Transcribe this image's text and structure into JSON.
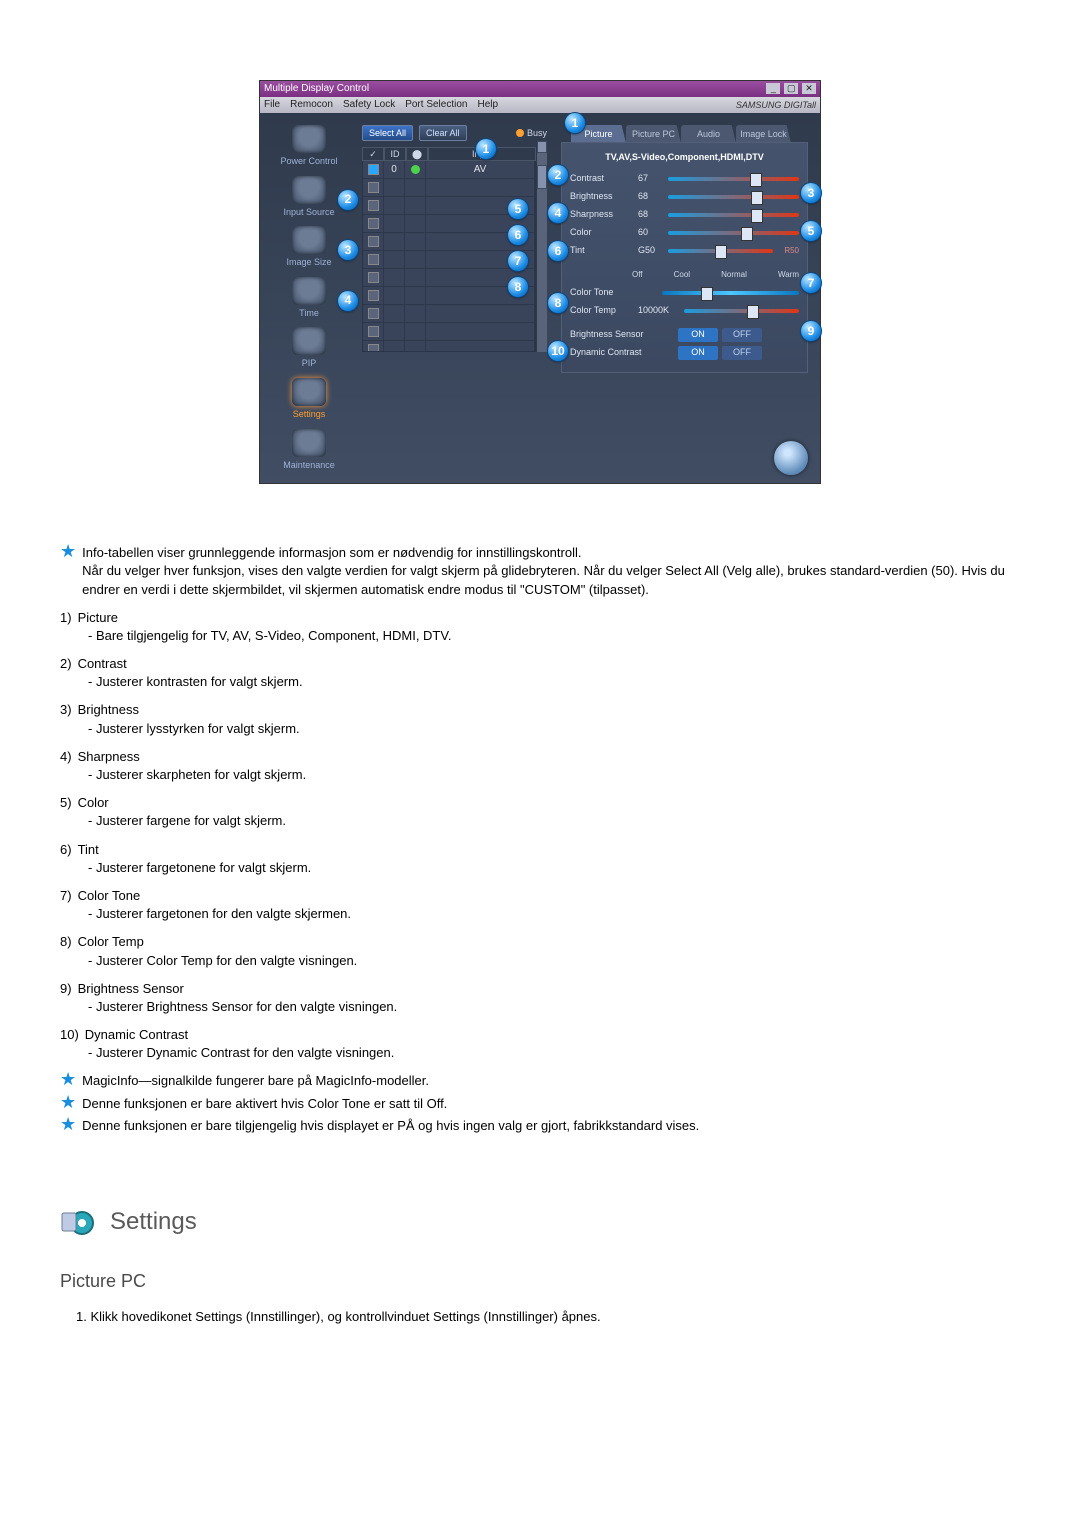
{
  "app": {
    "title": "Multiple Display Control",
    "window_buttons": [
      "_",
      "▢",
      "✕"
    ],
    "menu": [
      "File",
      "Remocon",
      "Safety Lock",
      "Port Selection",
      "Help"
    ],
    "brand": "SAMSUNG DIGITall",
    "sidebar": [
      {
        "label": "Power Control"
      },
      {
        "label": "Input Source"
      },
      {
        "label": "Image Size"
      },
      {
        "label": "Time"
      },
      {
        "label": "PIP"
      },
      {
        "label": "Settings",
        "active": true
      },
      {
        "label": "Maintenance"
      }
    ],
    "buttons": {
      "select_all": "Select All",
      "clear_all": "Clear All",
      "busy": "Busy"
    },
    "grid": {
      "headers": {
        "id": "ID",
        "input": "Input"
      },
      "input_value": "AV",
      "id_first": "0"
    },
    "tabs": [
      "Picture",
      "Picture PC",
      "Audio",
      "Image Lock"
    ],
    "panel_caption": "TV,AV,S-Video,Component,HDMI,DTV",
    "sliders": {
      "contrast": {
        "label": "Contrast",
        "value": "67"
      },
      "brightness": {
        "label": "Brightness",
        "value": "68"
      },
      "sharpness": {
        "label": "Sharpness",
        "value": "68"
      },
      "color": {
        "label": "Color",
        "value": "60"
      },
      "tint": {
        "label": "Tint",
        "left": "G50",
        "right": "R50"
      }
    },
    "tone": {
      "label": "Color Tone",
      "options": [
        "Off",
        "Cool",
        "Normal",
        "Warm"
      ]
    },
    "temp": {
      "label": "Color Temp",
      "value": "10000K"
    },
    "bs": {
      "label": "Brightness Sensor",
      "on": "ON",
      "off": "OFF"
    },
    "dc": {
      "label": "Dynamic Contrast",
      "on": "ON",
      "off": "OFF"
    }
  },
  "callouts": [
    "1",
    "2",
    "3",
    "4",
    "5",
    "6",
    "7",
    "8",
    "9",
    "10"
  ],
  "side_badges": [
    "2",
    "3",
    "4"
  ],
  "center_badges": [
    "1",
    "5",
    "6",
    "7",
    "8"
  ],
  "right_badges": [
    "2",
    "3",
    "4",
    "5",
    "6",
    "7",
    "8",
    "9"
  ],
  "doc": {
    "intro": [
      "Info-tabellen viser grunnleggende informasjon som er nødvendig for innstillingskontroll.",
      "Når du velger hver funksjon, vises den valgte verdien for valgt skjerm på glidebryteren. Når du velger Select All (Velg alle), brukes standard-verdien (50). Hvis du endrer en verdi i dette skjermbildet, vil skjermen automatisk endre modus til \"CUSTOM\" (tilpasset)."
    ],
    "items": [
      {
        "n": "1)",
        "t": "Picture",
        "s": "- Bare tilgjengelig for TV, AV, S-Video, Component, HDMI, DTV."
      },
      {
        "n": "2)",
        "t": "Contrast",
        "s": "- Justerer kontrasten for valgt skjerm."
      },
      {
        "n": "3)",
        "t": "Brightness",
        "s": "- Justerer lysstyrken for valgt skjerm."
      },
      {
        "n": "4)",
        "t": "Sharpness",
        "s": "- Justerer skarpheten for valgt skjerm."
      },
      {
        "n": "5)",
        "t": "Color",
        "s": "- Justerer fargene for valgt skjerm."
      },
      {
        "n": "6)",
        "t": "Tint",
        "s": "- Justerer fargetonene for valgt skjerm."
      },
      {
        "n": "7)",
        "t": "Color Tone",
        "s": "- Justerer fargetonen for den valgte skjermen."
      },
      {
        "n": "8)",
        "t": "Color Temp",
        "s": "- Justerer Color Temp for den valgte visningen."
      },
      {
        "n": "9)",
        "t": "Brightness Sensor",
        "s": "- Justerer Brightness Sensor for den valgte visningen."
      },
      {
        "n": "10)",
        "t": "Dynamic Contrast",
        "s": "- Justerer Dynamic Contrast for den valgte visningen."
      }
    ],
    "notes": [
      "MagicInfo—signalkilde fungerer bare på MagicInfo-modeller.",
      "Denne funksjonen er bare aktivert hvis Color Tone er satt til Off.",
      "Denne funksjonen er bare tilgjengelig hvis displayet er PÅ og hvis ingen valg er gjort, fabrikkstandard vises."
    ],
    "section_title": "Settings",
    "h2": "Picture PC",
    "step1": "1. Klikk hovedikonet Settings (Innstillinger), og kontrollvinduet Settings (Innstillinger) åpnes."
  }
}
